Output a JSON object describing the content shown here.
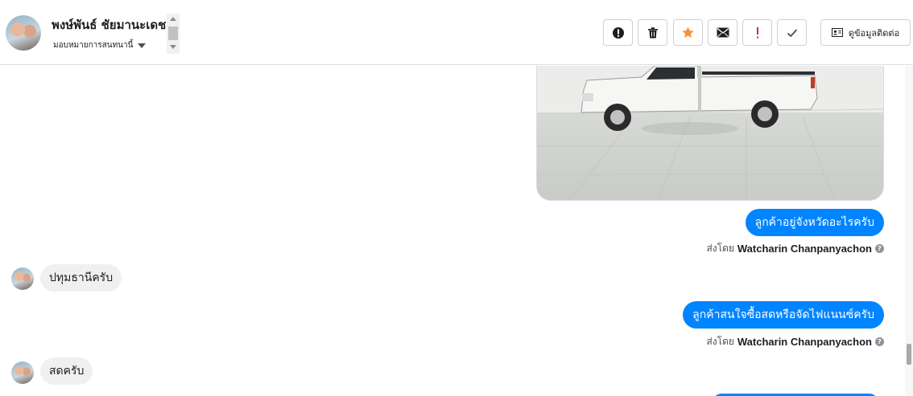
{
  "header": {
    "contact_name": "พงษ์พันธ์ ชัยมานะเดช",
    "assign_label": "มอบหมายการสนทนานี้",
    "toolbar": [
      {
        "name": "mark-spam-button",
        "icon": "exclamation-circle-icon"
      },
      {
        "name": "delete-button",
        "icon": "trash-icon"
      },
      {
        "name": "star-button",
        "icon": "star-icon"
      },
      {
        "name": "mark-unread-button",
        "icon": "envelope-icon"
      },
      {
        "name": "mark-important-button",
        "icon": "red-exclamation-icon"
      },
      {
        "name": "mark-done-button",
        "icon": "check-icon"
      }
    ],
    "contact_info_label": "ดูข้อมูลติดต่อ"
  },
  "messages": [
    {
      "type": "image",
      "description_icon": "photo"
    },
    {
      "type": "outgoing",
      "text": "ลูกค้าอยู่จังหวัดอะไรครับ",
      "sent_by_prefix": "ส่งโดย",
      "sender": "Watcharin Chanpanyachon"
    },
    {
      "type": "incoming",
      "text": "ปทุมธานีครับ"
    },
    {
      "type": "outgoing",
      "text": "ลูกค้าสนใจซื้อสดหรือจัดไฟแนนซ์ครับ",
      "sent_by_prefix": "ส่งโดย",
      "sender": "Watcharin Chanpanyachon"
    },
    {
      "type": "incoming",
      "text": "สดครับ"
    }
  ],
  "colors": {
    "outgoing_bubble": "#0084ff",
    "incoming_bubble": "#f1f0f0",
    "star": "#f7923b",
    "important": "#e41e3f"
  }
}
